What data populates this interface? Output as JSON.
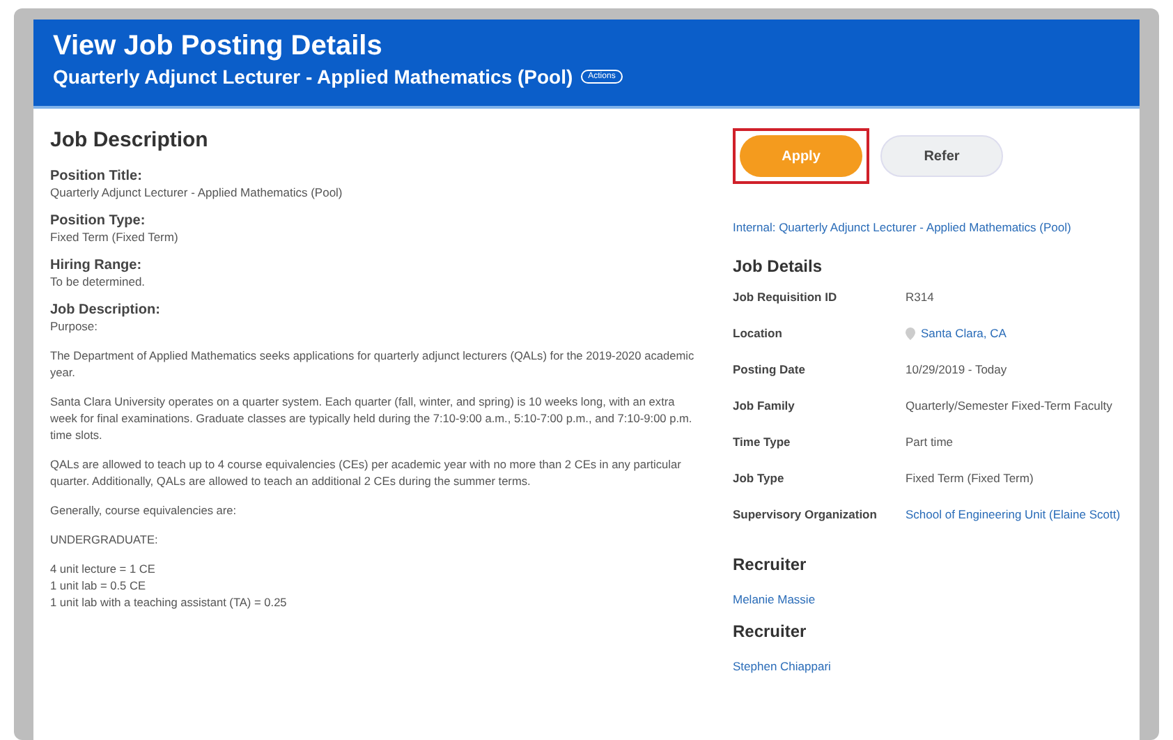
{
  "header": {
    "title": "View Job Posting Details",
    "subtitle": "Quarterly Adjunct Lecturer - Applied Mathematics (Pool)",
    "actions_badge": "Actions"
  },
  "description": {
    "heading": "Job Description",
    "fields": [
      {
        "label": "Position Title:",
        "value": "Quarterly Adjunct Lecturer - Applied Mathematics (Pool)"
      },
      {
        "label": "Position Type:",
        "value": "Fixed Term (Fixed Term)"
      },
      {
        "label": "Hiring Range:",
        "value": "To be determined."
      },
      {
        "label": "Job Description:",
        "value": "Purpose:"
      }
    ],
    "paragraphs": [
      [
        "The Department of Applied Mathematics seeks applications for quarterly adjunct lecturers (QALs) for the 2019-2020 academic year."
      ],
      [
        "Santa Clara University operates on a quarter system. Each quarter (fall, winter, and spring) is 10 weeks long, with an extra week for final examinations. Graduate classes are typically held during the 7:10-9:00 a.m., 5:10-7:00 p.m., and 7:10-9:00 p.m. time slots."
      ],
      [
        "QALs are allowed to teach up to 4 course equivalencies (CEs) per academic year with no more than 2 CEs in any particular quarter. Additionally, QALs are allowed to teach an additional 2 CEs during the summer terms."
      ],
      [
        "Generally, course equivalencies are:"
      ],
      [
        "UNDERGRADUATE:"
      ],
      [
        "4 unit lecture = 1 CE",
        "1 unit lab = 0.5 CE",
        "1 unit lab with a teaching assistant (TA) = 0.25"
      ]
    ]
  },
  "buttons": [
    {
      "label": "Apply",
      "kind": "primary",
      "highlighted": true
    },
    {
      "label": "Refer",
      "kind": "secondary",
      "highlighted": false
    }
  ],
  "internal_link": "Internal: Quarterly Adjunct Lecturer - Applied Mathematics (Pool)",
  "job_details": {
    "heading": "Job Details",
    "rows": [
      {
        "label": "Job Requisition ID",
        "value": "R314",
        "kind": "text"
      },
      {
        "label": "Location",
        "value": "Santa Clara, CA",
        "kind": "location"
      },
      {
        "label": "Posting Date",
        "value": "10/29/2019 - Today",
        "kind": "text"
      },
      {
        "label": "Job Family",
        "value": "Quarterly/Semester Fixed-Term Faculty",
        "kind": "text"
      },
      {
        "label": "Time Type",
        "value": "Part time",
        "kind": "text"
      },
      {
        "label": "Job Type",
        "value": "Fixed Term (Fixed Term)",
        "kind": "text"
      },
      {
        "label": "Supervisory Organization",
        "value": "School of Engineering Unit (Elaine Scott)",
        "kind": "link"
      }
    ]
  },
  "recruiters": [
    {
      "heading": "Recruiter",
      "name": "Melanie Massie"
    },
    {
      "heading": "Recruiter",
      "name": "Stephen Chiappari"
    }
  ]
}
